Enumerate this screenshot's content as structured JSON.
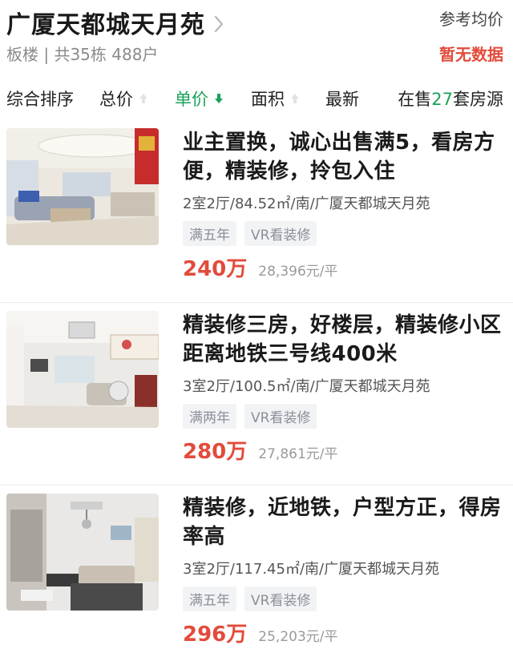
{
  "header": {
    "title": "广厦天都城天月苑",
    "subtitle": "板楼 | 共35栋 488户",
    "avg_label": "参考均价",
    "avg_value": "暂无数据"
  },
  "sortbar": {
    "items": [
      {
        "label": "综合排序"
      },
      {
        "label": "总价"
      },
      {
        "label": "单价"
      },
      {
        "label": "面积"
      },
      {
        "label": "最新"
      }
    ],
    "count_prefix": "在售",
    "count_num": "27",
    "count_suffix": "套房源",
    "active_color": "#1aa15a"
  },
  "listings": [
    {
      "title": "业主置换，诚心出售满5，看房方便，精装修，拎包入住",
      "meta": "2室2厅/84.52㎡/南/广厦天都城天月苑",
      "tags": [
        "满五年",
        "VR看装修"
      ],
      "price": "240万",
      "unit_price": "28,396元/平"
    },
    {
      "title": "精装修三房，好楼层，精装修小区距离地铁三号线400米",
      "meta": "3室2厅/100.5㎡/南/广厦天都城天月苑",
      "tags": [
        "满两年",
        "VR看装修"
      ],
      "price": "280万",
      "unit_price": "27,861元/平"
    },
    {
      "title": "精装修，近地铁，户型方正，得房率高",
      "meta": "3室2厅/117.45㎡/南/广厦天都城天月苑",
      "tags": [
        "满五年",
        "VR看装修"
      ],
      "price": "296万",
      "unit_price": "25,203元/平"
    }
  ],
  "colors": {
    "price": "#e24b3b",
    "accent": "#1aa15a"
  }
}
